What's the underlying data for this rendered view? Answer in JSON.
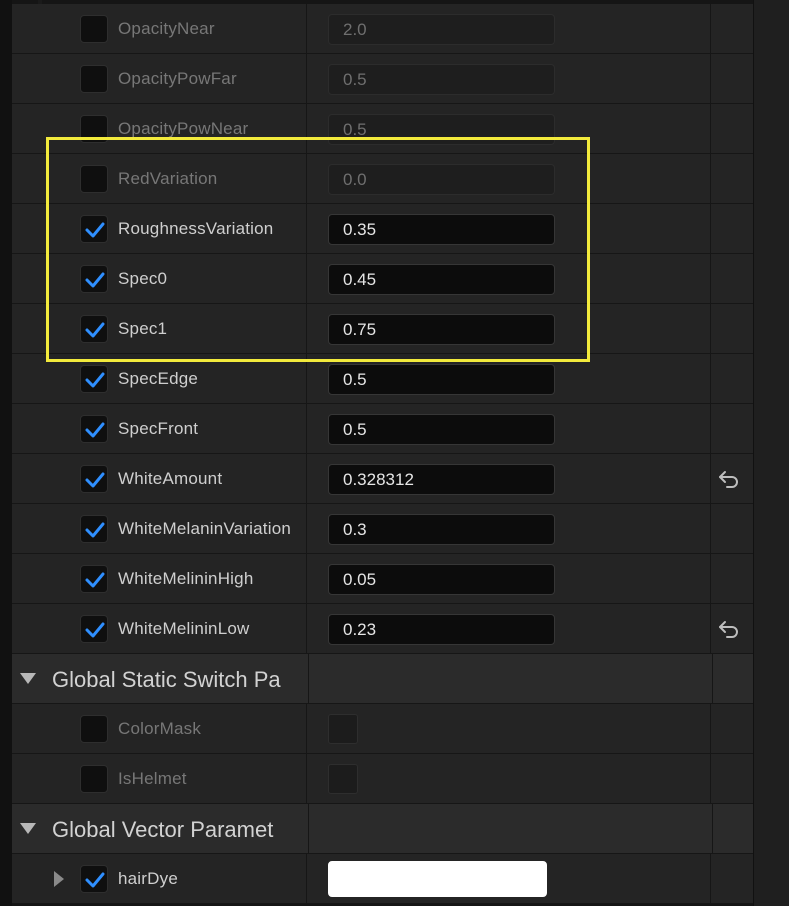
{
  "scalar_params": [
    {
      "name": "OpacityNear",
      "value": "2.0",
      "enabled": false,
      "reset": false
    },
    {
      "name": "OpacityPowFar",
      "value": "0.5",
      "enabled": false,
      "reset": false
    },
    {
      "name": "OpacityPowNear",
      "value": "0.5",
      "enabled": false,
      "reset": false
    },
    {
      "name": "RedVariation",
      "value": "0.0",
      "enabled": false,
      "reset": false
    },
    {
      "name": "RoughnessVariation",
      "value": "0.35",
      "enabled": true,
      "reset": false
    },
    {
      "name": "Spec0",
      "value": "0.45",
      "enabled": true,
      "reset": false
    },
    {
      "name": "Spec1",
      "value": "0.75",
      "enabled": true,
      "reset": false
    },
    {
      "name": "SpecEdge",
      "value": "0.5",
      "enabled": true,
      "reset": false
    },
    {
      "name": "SpecFront",
      "value": "0.5",
      "enabled": true,
      "reset": false
    },
    {
      "name": "WhiteAmount",
      "value": "0.328312",
      "enabled": true,
      "reset": true
    },
    {
      "name": "WhiteMelaninVariation",
      "value": "0.3",
      "enabled": true,
      "reset": false
    },
    {
      "name": "WhiteMelininHigh",
      "value": "0.05",
      "enabled": true,
      "reset": false
    },
    {
      "name": "WhiteMelininLow",
      "value": "0.23",
      "enabled": true,
      "reset": true
    }
  ],
  "static_switch_section": {
    "title": "Global Static Switch Pa"
  },
  "static_switch_params": [
    {
      "name": "ColorMask",
      "enabled": false
    },
    {
      "name": "IsHelmet",
      "enabled": false
    }
  ],
  "vector_section": {
    "title": "Global Vector Paramet"
  },
  "vector_params": [
    {
      "name": "hairDye",
      "enabled": true,
      "color": "#ffffff"
    }
  ],
  "colors": {
    "accent_check": "#2f8fff",
    "highlight_box": "#f2ea3c",
    "row_bg": "#242424",
    "field_bg": "#0c0c0c"
  },
  "icons": {
    "check": "check-icon",
    "reset": "reset-arrow-icon",
    "collapse": "triangle-down-icon",
    "expand": "triangle-right-icon"
  }
}
